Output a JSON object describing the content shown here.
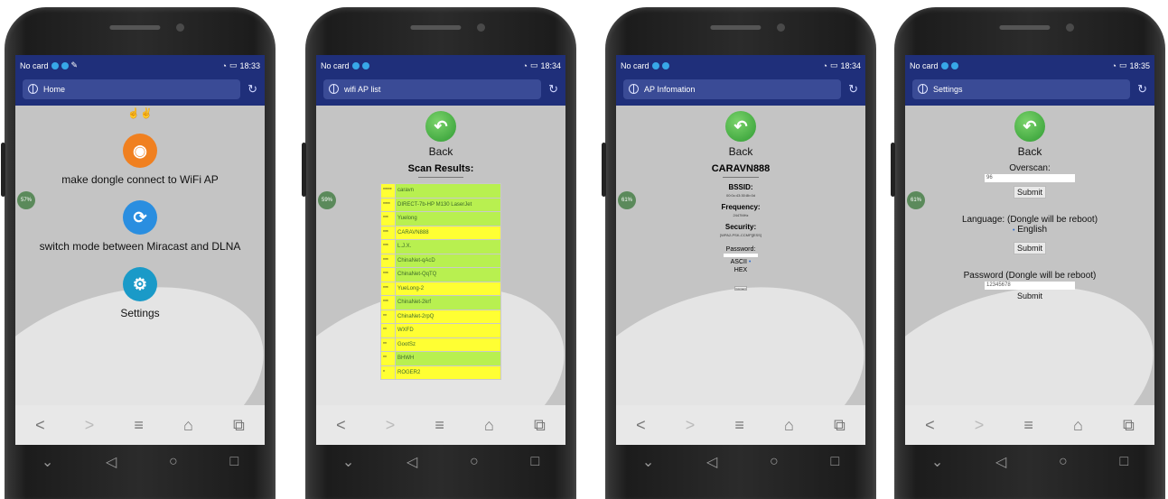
{
  "phone1": {
    "status": {
      "carrier": "No card",
      "time": "18:33"
    },
    "title": "Home",
    "battery_badge": "57%",
    "menu": [
      {
        "label": "make dongle connect to WiFi AP",
        "icon": "rss-icon",
        "color": "#f08020"
      },
      {
        "label": "switch mode between Miracast and DLNA",
        "icon": "sync-icon",
        "color": "#2a8ee0"
      },
      {
        "label": "Settings",
        "icon": "gear-icon",
        "color": "#1a9ac8"
      }
    ]
  },
  "phone2": {
    "status": {
      "carrier": "No card",
      "time": "18:34"
    },
    "title": "wifi AP list",
    "battery_badge": "59%",
    "back": "Back",
    "scan_title": "Scan Results:",
    "rows": [
      {
        "q": "*****",
        "name": "caravn",
        "color": "green"
      },
      {
        "q": "****",
        "name": "DIRECT-7b-HP M130 LaserJet",
        "color": "green"
      },
      {
        "q": "***",
        "name": "Yuelong",
        "color": "green"
      },
      {
        "q": "***",
        "name": "CARAVN888",
        "color": "yellow"
      },
      {
        "q": "***",
        "name": "L.J.X.",
        "color": "green"
      },
      {
        "q": "***",
        "name": "ChinaNet-qAcD",
        "color": "green"
      },
      {
        "q": "***",
        "name": "ChinaNet-QqTQ",
        "color": "green"
      },
      {
        "q": "***",
        "name": "YueLong-2",
        "color": "yellow"
      },
      {
        "q": "***",
        "name": "ChinaNet-2krf",
        "color": "green"
      },
      {
        "q": "**",
        "name": "ChinaNet-2rpQ",
        "color": "yellow"
      },
      {
        "q": "**",
        "name": "WXFD",
        "color": "yellow"
      },
      {
        "q": "**",
        "name": "GootSz",
        "color": "yellow"
      },
      {
        "q": "**",
        "name": "BHWH",
        "color": "green"
      },
      {
        "q": "*",
        "name": "ROGER2",
        "color": "yellow"
      }
    ]
  },
  "phone3": {
    "status": {
      "carrier": "No card",
      "time": "18:34"
    },
    "title": "AP Infomation",
    "battery_badge": "61%",
    "back": "Back",
    "ap_name": "CARAVN888",
    "bssid_label": "BSSID:",
    "bssid_value": "00:0c:43:30:8b:0d",
    "freq_label": "Frequency:",
    "freq_value": "2447MHz",
    "security_label": "Security:",
    "security_value": "[WPA2-PSK-CCMP][ESS]",
    "password_label": "Password:",
    "ascii": "ASCII",
    "hex": "HEX",
    "connect": "Connect"
  },
  "phone4": {
    "status": {
      "carrier": "No card",
      "time": "18:35"
    },
    "title": "Settings",
    "battery_badge": "61%",
    "back": "Back",
    "overscan_label": "Overscan:",
    "overscan_value": "96",
    "submit": "Submit",
    "language_label": "Language: (Dongle will be reboot)",
    "language_value": "English",
    "password_label": "Password (Dongle will be reboot)",
    "password_value": "12345678"
  },
  "nav": {
    "back": "<",
    "forward": ">",
    "menu": "≡",
    "home": "⌂",
    "tabs": "⧉"
  },
  "sys": {
    "down": "⌄",
    "back": "◁",
    "home": "○",
    "recent": "□"
  }
}
